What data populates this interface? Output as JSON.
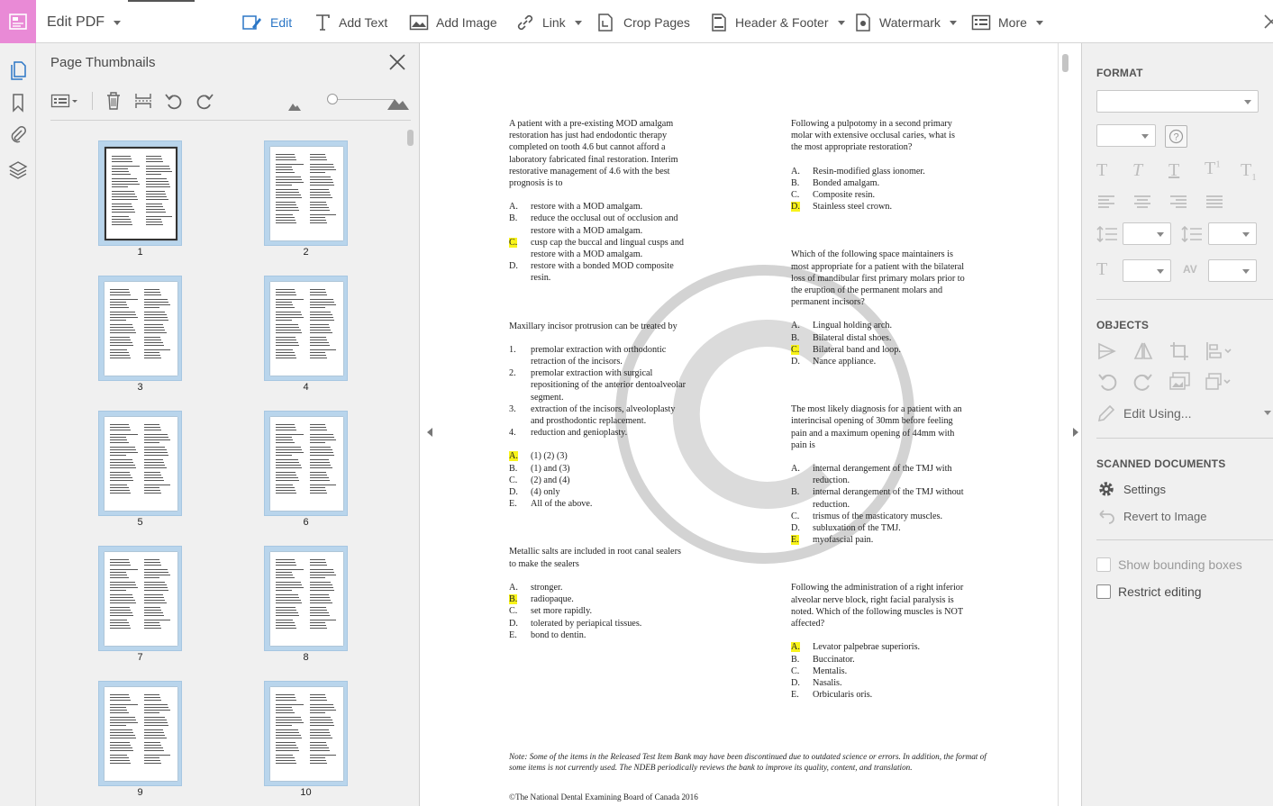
{
  "toolbar": {
    "tool_name": "Edit PDF",
    "buttons": [
      {
        "label": "Edit"
      },
      {
        "label": "Add Text"
      },
      {
        "label": "Add Image"
      },
      {
        "label": "Link"
      },
      {
        "label": "Crop Pages"
      },
      {
        "label": "Header & Footer"
      },
      {
        "label": "Watermark"
      },
      {
        "label": "More"
      }
    ]
  },
  "left_rail": {
    "icons": [
      "page-thumbnails-icon",
      "bookmark-icon",
      "attachment-icon",
      "layers-icon"
    ]
  },
  "thumbnails_panel": {
    "title": "Page Thumbnails",
    "selected_page": 1,
    "pages": [
      "1",
      "2",
      "3",
      "4",
      "5",
      "6",
      "7",
      "8",
      "9",
      "10"
    ]
  },
  "document": {
    "left_column": [
      {
        "question": "A patient with a pre-existing MOD amalgam\nrestoration has just had endodontic therapy\ncompleted on tooth 4.6 but cannot afford a\nlaboratory fabricated final restoration. Interim\nrestorative management of 4.6 with the best\nprognosis is to",
        "options": [
          {
            "letter": "A.",
            "text": "restore with a MOD amalgam.",
            "highlight": false
          },
          {
            "letter": "B.",
            "text": "reduce the occlusal out of occlusion and\nrestore with a MOD amalgam.",
            "highlight": false
          },
          {
            "letter": "C.",
            "text": "cusp cap the buccal and lingual cusps and\nrestore with a MOD amalgam.",
            "highlight": true
          },
          {
            "letter": "D.",
            "text": "restore with a bonded MOD composite\nresin.",
            "highlight": false
          }
        ]
      },
      {
        "question": "Maxillary incisor protrusion can be treated by",
        "numbered": [
          {
            "letter": "1.",
            "text": "premolar extraction with orthodontic\nretraction of the incisors."
          },
          {
            "letter": "2.",
            "text": "premolar extraction with surgical\nrepositioning of the anterior dentoalveolar\nsegment."
          },
          {
            "letter": "3.",
            "text": "extraction of the incisors, alveoloplasty\nand prosthodontic replacement."
          },
          {
            "letter": "4.",
            "text": "reduction and genioplasty."
          }
        ],
        "options": [
          {
            "letter": "A.",
            "text": "(1) (2) (3)",
            "highlight": true
          },
          {
            "letter": "B.",
            "text": "(1) and (3)",
            "highlight": false
          },
          {
            "letter": "C.",
            "text": "(2) and (4)",
            "highlight": false
          },
          {
            "letter": "D.",
            "text": "(4) only",
            "highlight": false
          },
          {
            "letter": "E.",
            "text": "All of the above.",
            "highlight": false
          }
        ]
      },
      {
        "question": "Metallic salts are included in root canal sealers\nto make the sealers",
        "options": [
          {
            "letter": "A.",
            "text": "stronger.",
            "highlight": false
          },
          {
            "letter": "B.",
            "text": "radiopaque.",
            "highlight": true
          },
          {
            "letter": "C.",
            "text": "set more rapidly.",
            "highlight": false
          },
          {
            "letter": "D.",
            "text": "tolerated by periapical tissues.",
            "highlight": false
          },
          {
            "letter": "E.",
            "text": "bond to dentin.",
            "highlight": false
          }
        ]
      }
    ],
    "right_column": [
      {
        "question": "Following a pulpotomy in a second primary\nmolar with extensive occlusal caries, what is\nthe most appropriate restoration?",
        "options": [
          {
            "letter": "A.",
            "text": "Resin-modified glass ionomer.",
            "highlight": false
          },
          {
            "letter": "B.",
            "text": "Bonded amalgam.",
            "highlight": false
          },
          {
            "letter": "C.",
            "text": "Composite resin.",
            "highlight": false
          },
          {
            "letter": "D.",
            "text": "Stainless steel crown.",
            "highlight": true
          }
        ]
      },
      {
        "question": "Which of the following space maintainers is\nmost appropriate for a patient with the bilateral\nloss of mandibular first primary molars prior to\nthe eruption of the permanent molars and\npermanent incisors?",
        "options": [
          {
            "letter": "A.",
            "text": "Lingual holding arch.",
            "highlight": false
          },
          {
            "letter": "B.",
            "text": "Bilateral distal shoes.",
            "highlight": false
          },
          {
            "letter": "C.",
            "text": "Bilateral band and loop.",
            "highlight": true
          },
          {
            "letter": "D.",
            "text": "Nance appliance.",
            "highlight": false
          }
        ]
      },
      {
        "question": "The most likely diagnosis for a patient with an\ninterincisal opening of 30mm before feeling\npain and a maximum opening of 44mm with\npain is",
        "options": [
          {
            "letter": "A.",
            "text": "internal derangement of the TMJ with\nreduction.",
            "highlight": false
          },
          {
            "letter": "B.",
            "text": "internal derangement of the TMJ without\nreduction.",
            "highlight": false
          },
          {
            "letter": "C.",
            "text": "trismus of the masticatory muscles.",
            "highlight": false
          },
          {
            "letter": "D.",
            "text": "subluxation of the TMJ.",
            "highlight": false
          },
          {
            "letter": "E.",
            "text": "myofascial pain.",
            "highlight": true
          }
        ]
      },
      {
        "question": "Following the administration of a right inferior\nalveolar nerve block, right facial paralysis is\nnoted.  Which of the following muscles is NOT\naffected?",
        "options": [
          {
            "letter": "A.",
            "text": "Levator palpebrae superioris.",
            "highlight": true
          },
          {
            "letter": "B.",
            "text": "Buccinator.",
            "highlight": false
          },
          {
            "letter": "C.",
            "text": "Mentalis.",
            "highlight": false
          },
          {
            "letter": "D.",
            "text": "Nasalis.",
            "highlight": false
          },
          {
            "letter": "E.",
            "text": "Orbicularis oris.",
            "highlight": false
          }
        ]
      }
    ],
    "note": "Note:  Some of the items in the Released Test Item Bank may have been discontinued due to outdated science or errors. In addition, the format of some items is not currently used. The NDEB periodically reviews the bank to improve its quality, content, and translation.",
    "copyright": "©The National Dental Examining Board of Canada 2016",
    "highlight_color": "#f8f31a"
  },
  "format_panel": {
    "format_heading": "FORMAT",
    "objects_heading": "OBJECTS",
    "edit_using_label": "Edit Using...",
    "scanned_heading": "SCANNED DOCUMENTS",
    "settings_label": "Settings",
    "revert_label": "Revert to Image",
    "show_bounding_boxes_label": "Show bounding boxes",
    "restrict_editing_label": "Restrict editing"
  },
  "colors": {
    "accent": "#2b76c6",
    "tool_tile": "#e98ad6"
  }
}
